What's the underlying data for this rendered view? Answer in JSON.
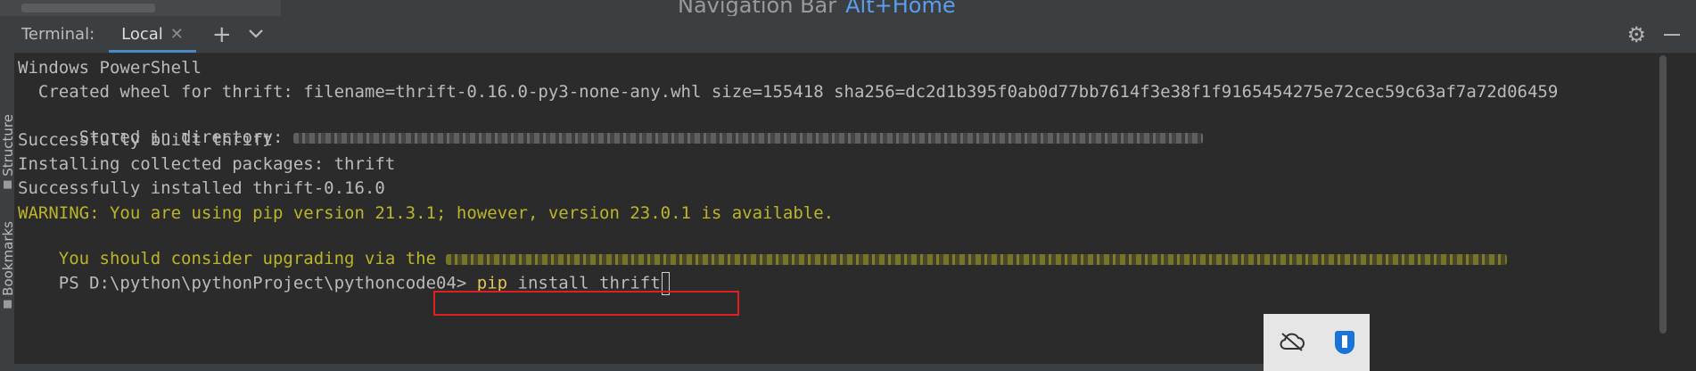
{
  "top_bar": {
    "navigation_hint": "Navigation Bar",
    "navigation_shortcut": "Alt+Home"
  },
  "side_tools": {
    "structure": "Structure",
    "bookmarks": "Bookmarks"
  },
  "terminal": {
    "title": "Terminal:",
    "tabs": [
      {
        "label": "Local",
        "active": true
      }
    ],
    "add_tab_icon": "+",
    "tab_menu_icon": "chevron-down",
    "settings_icon": "gear",
    "hide_icon": "minimize"
  },
  "output": {
    "l1": "Windows PowerShell",
    "l2": "  Created wheel for thrift: filename=thrift-0.16.0-py3-none-any.whl size=155418 sha256=dc2d1b395f0ab0d77bb7614f3e38f1f9165454275e72cec59c63af7a72d06459",
    "l3": "  Stored in directory: ",
    "l4": "Successfully built thrift",
    "l5": "Installing collected packages: thrift",
    "l6": "Successfully installed thrift-0.16.0",
    "l7": "WARNING: You are using pip version 21.3.1; however, version 23.0.1 is available.",
    "l8": "You should consider upgrading via the "
  },
  "prompt": {
    "path": "PS D:\\python\\pythonProject\\pythoncode04> ",
    "command": "pip",
    "args": " install thrift"
  },
  "colors": {
    "background": "#2b2b2b",
    "header": "#3c3f41",
    "text": "#bbbbbb",
    "warning": "#bbb529",
    "command": "#e3c45a",
    "highlight_border": "#e02020",
    "accent": "#4a88c7"
  },
  "tray": {
    "icons": [
      "cloud-off-icon",
      "defender-shield-icon"
    ]
  }
}
